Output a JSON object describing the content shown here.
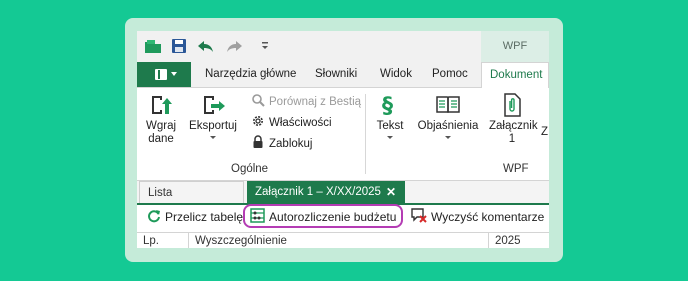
{
  "colors": {
    "accent": "#1e7a4c",
    "background": "#14c994",
    "highlight": "#b43cb4"
  },
  "qat": {
    "icons": [
      "folder-icon",
      "save-icon",
      "undo-icon",
      "redo-icon",
      "customize-icon"
    ],
    "context_label": "WPF"
  },
  "tabs": [
    "Narzędzia główne",
    "Słowniki",
    "Widok",
    "Pomoc",
    "Dokument"
  ],
  "ribbon": {
    "import_label_1": "Wgraj",
    "import_label_2": "dane",
    "export_label": "Eksportuj",
    "compare_label": "Porównaj z Bestią",
    "properties_label": "Właściwości",
    "lock_label": "Zablokuj",
    "group_general": "Ogólne",
    "text_label": "Tekst",
    "explanations_label": "Objaśnienia",
    "attachment_label_1": "Załącznik",
    "attachment_label_2": "1",
    "partial_label": "Z",
    "group_wpf": "WPF"
  },
  "doc_tabs": {
    "inactive": "Lista dokumentów",
    "active": "Załącznik 1 – X/XX/2025",
    "close": "✕"
  },
  "toolbar": {
    "recalc": "Przelicz tabelę",
    "autocalc": "Autorozliczenie budżetu",
    "clear_comments": "Wyczyść komentarze"
  },
  "grid": {
    "columns": [
      "Lp.",
      "Wyszczególnienie",
      "2025"
    ]
  }
}
